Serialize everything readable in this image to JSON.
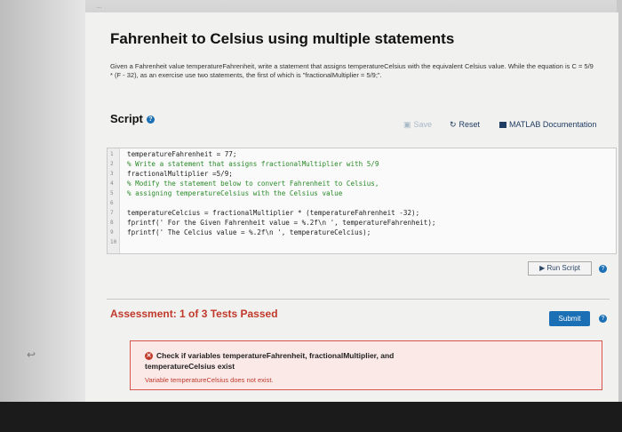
{
  "browser": {
    "tab_title": "..."
  },
  "page": {
    "title": "Fahrenheit to Celsius using multiple statements",
    "description": "Given a Fahrenheit value temperatureFahrenheit, write a statement that assigns temperatureCelsius with the equivalent Celsius value. While the equation is C = 5/9 * (F - 32), as an exercise use two statements, the first of which is \"fractionalMultiplier = 5/9;\"."
  },
  "script": {
    "heading": "Script",
    "info_icon": "?",
    "save_label": "Save",
    "reset_label": "Reset",
    "doc_label": "MATLAB Documentation",
    "lines": [
      {
        "num": "1",
        "text": "temperatureFahrenheit = 77;",
        "type": "code"
      },
      {
        "num": "2",
        "text": "% Write a statement that assigns fractionalMultiplier with 5/9",
        "type": "comment"
      },
      {
        "num": "3",
        "text": "fractionalMultiplier =5/9;",
        "type": "code"
      },
      {
        "num": "4",
        "text": "% Modify the statement below to convert Fahrenheit to Celsius,",
        "type": "comment"
      },
      {
        "num": "5",
        "text": "% assigning temperatureCelsius with the Celsius value",
        "type": "comment"
      },
      {
        "num": "6",
        "text": "",
        "type": "code"
      },
      {
        "num": "7",
        "text": "temperatureCelcius = fractionalMultiplier * (temperatureFahrenheit -32);",
        "type": "code"
      },
      {
        "num": "8",
        "text": "fprintf(' For the Given Fahrenheit value = %.2f\\n ', temperatureFahrenheit);",
        "type": "code"
      },
      {
        "num": "9",
        "text": "fprintf(' The Celcius value = %.2f\\n ', temperatureCelcius);",
        "type": "code"
      },
      {
        "num": "10",
        "text": "",
        "type": "code"
      }
    ],
    "run_label": "Run Script"
  },
  "assessment": {
    "heading": "Assessment: 1 of 3 Tests Passed",
    "submit_label": "Submit",
    "test": {
      "title": "Check if variables temperatureFahrenheit, fractionalMultiplier, and temperatureCelsius exist",
      "message": "Variable temperatureCelsius does not exist."
    }
  },
  "colors": {
    "accent": "#1a6fb5",
    "error": "#c0392b",
    "comment": "#2a8a2a"
  }
}
